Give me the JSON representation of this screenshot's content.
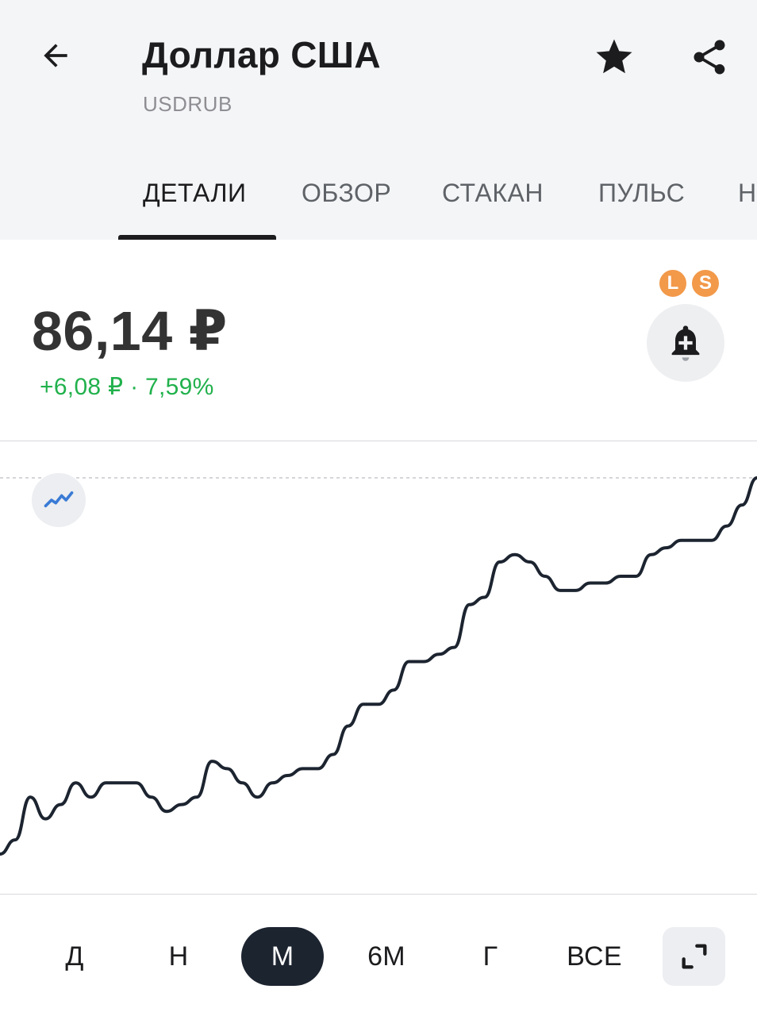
{
  "header": {
    "title": "Доллар США",
    "ticker": "USDRUB",
    "back_icon": "arrow-left-icon",
    "favorite_icon": "star-icon",
    "share_icon": "share-icon"
  },
  "tabs": [
    {
      "label": "ДЕТАЛИ",
      "active": true
    },
    {
      "label": "ОБЗОР",
      "active": false
    },
    {
      "label": "СТАКАН",
      "active": false
    },
    {
      "label": "ПУЛЬС",
      "active": false
    },
    {
      "label": "Н",
      "active": false
    }
  ],
  "quote": {
    "price": "86,14 ₽",
    "change": "+6,08 ₽ · 7,59%",
    "change_color": "#21b14c"
  },
  "badges": {
    "l": "L",
    "s": "S",
    "color": "#f2994a"
  },
  "alert_icon": "bell-plus-icon",
  "chart_type_icon": "line-chart-icon",
  "periods": [
    {
      "label": "Д",
      "active": false
    },
    {
      "label": "Н",
      "active": false
    },
    {
      "label": "М",
      "active": true
    },
    {
      "label": "6М",
      "active": false
    },
    {
      "label": "Г",
      "active": false
    },
    {
      "label": "ВСЕ",
      "active": false
    }
  ],
  "expand_icon": "expand-icon",
  "chart_data": {
    "type": "line",
    "title": "",
    "xlabel": "",
    "ylabel": "",
    "grid": false,
    "line_color": "#1c2430",
    "series": [
      {
        "values": [
          80.06,
          80.29,
          80.98,
          80.63,
          80.86,
          81.21,
          80.98,
          81.21,
          81.21,
          81.21,
          80.98,
          80.75,
          80.86,
          80.98,
          81.56,
          81.44,
          81.21,
          80.98,
          81.21,
          81.33,
          81.44,
          81.44,
          81.67,
          82.13,
          82.48,
          82.48,
          82.71,
          83.17,
          83.17,
          83.29,
          83.4,
          84.09,
          84.21,
          84.78,
          84.9,
          84.78,
          84.55,
          84.32,
          84.32,
          84.44,
          84.44,
          84.55,
          84.55,
          84.9,
          85.01,
          85.13,
          85.13,
          85.13,
          85.36,
          85.7,
          86.14
        ]
      }
    ]
  }
}
